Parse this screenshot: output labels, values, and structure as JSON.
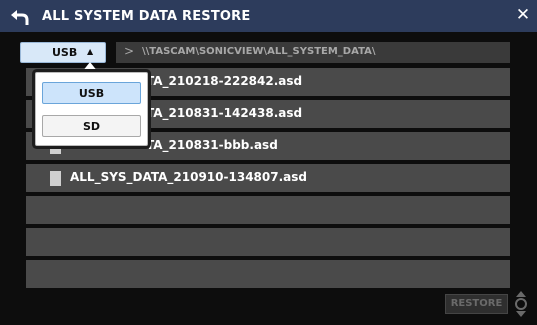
{
  "window": {
    "title": "ALL SYSTEM DATA RESTORE",
    "close_glyph": "✕"
  },
  "source": {
    "selected": "USB",
    "arrow_glyph": "▲"
  },
  "path": {
    "chevron_glyph": ">",
    "text": "\\\\TASCAM\\SONICVIEW\\ALL_SYSTEM_DATA\\"
  },
  "files": [
    {
      "name": "ALL_SYS_DATA_210218-222842.asd",
      "visible_text": "TA_210218-222842.asd"
    },
    {
      "name": "ALL_SYS_DATA_210831-142438.asd",
      "visible_text": "TA_210831-142438.asd"
    },
    {
      "name": "ALL_SYS_DATA_210831-bbb.asd",
      "visible_text": "TA_210831-bbb.asd"
    },
    {
      "name": "ALL_SYS_DATA_210910-134807.asd",
      "visible_text": "ALL_SYS_DATA_210910-134807.asd"
    }
  ],
  "dropdown": {
    "options": [
      "USB",
      "SD"
    ],
    "selected": "USB"
  },
  "footer": {
    "restore_label": "RESTORE"
  },
  "icons": {
    "back": "back-arrow-icon",
    "close": "close-icon",
    "file": "file-icon",
    "knob": "encoder-knob-icon"
  },
  "colors": {
    "titlebar": "#2d3c5c",
    "row": "#4a4a4a",
    "selected_option": "#cde4fb"
  }
}
